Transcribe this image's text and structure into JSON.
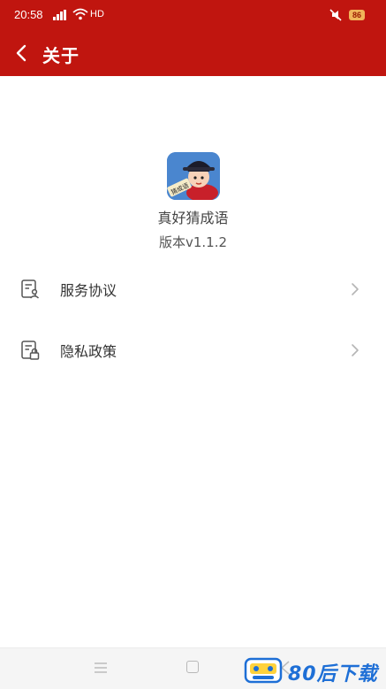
{
  "status_bar": {
    "time": "20:58",
    "network_label": "HD",
    "battery_level": "86",
    "icons": [
      "signal-icon",
      "wifi-icon",
      "mute-icon",
      "battery-icon"
    ]
  },
  "app_bar": {
    "back_icon": "chevron-left-icon",
    "title": "关于"
  },
  "app_info": {
    "icon_caption": "猜成语",
    "name": "真好猜成语",
    "version": "版本v1.1.2"
  },
  "menu": {
    "items": [
      {
        "label": "服务协议",
        "icon": "document-user-icon"
      },
      {
        "label": "隐私政策",
        "icon": "document-lock-icon"
      }
    ]
  },
  "nav_bar": {
    "icons": [
      "menu-icon",
      "home-icon",
      "back-icon"
    ]
  },
  "watermark": {
    "text": "80后下载"
  },
  "colors": {
    "primary": "#c0150f",
    "background": "#ffffff",
    "text": "#333333",
    "watermark": "#1e6fd6"
  }
}
